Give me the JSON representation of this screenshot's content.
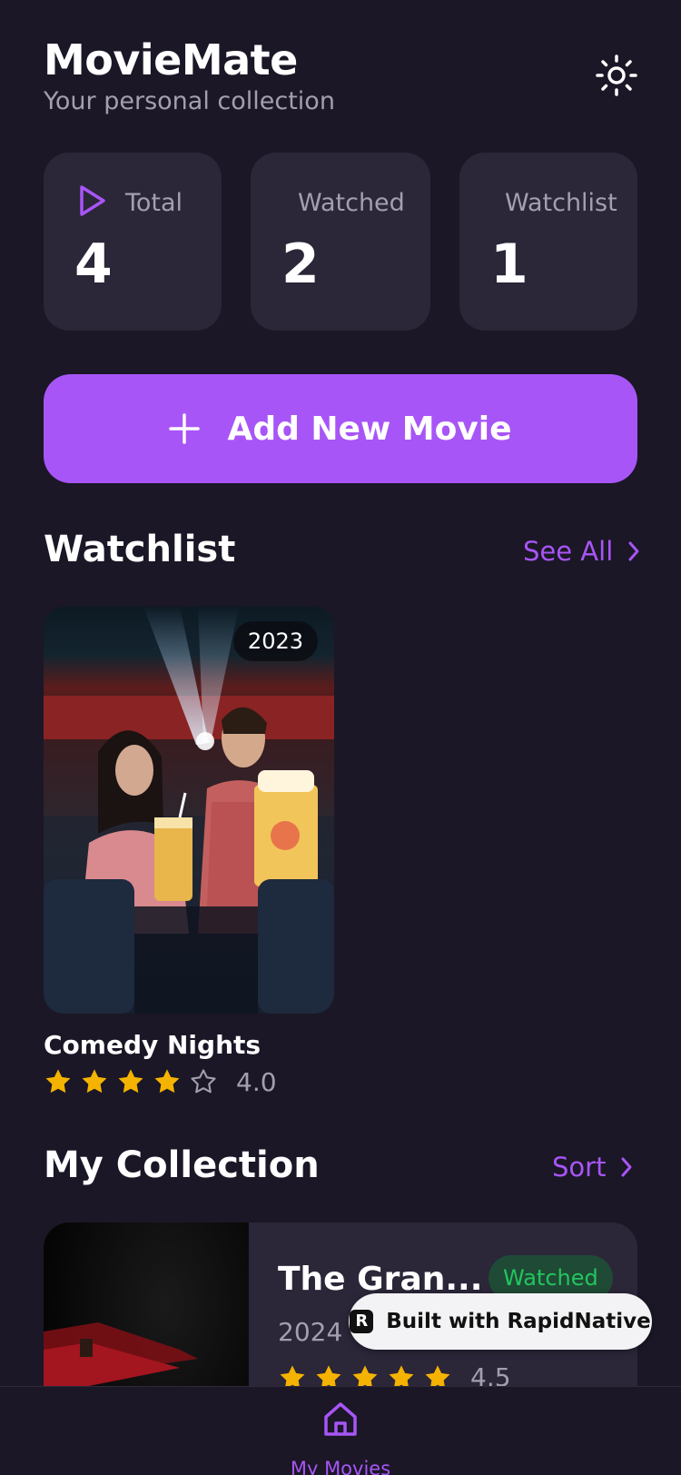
{
  "header": {
    "title": "MovieMate",
    "subtitle": "Your personal collection",
    "theme_icon": "sun-icon"
  },
  "stats": [
    {
      "label": "Total",
      "value": "4",
      "icon": "play-icon"
    },
    {
      "label": "Watched",
      "value": "2"
    },
    {
      "label": "Watchlist",
      "value": "1"
    }
  ],
  "add_button": {
    "label": "Add New Movie",
    "icon": "plus-icon"
  },
  "watchlist": {
    "title": "Watchlist",
    "see_all": "See All",
    "items": [
      {
        "title": "Comedy Nights",
        "year": "2023",
        "rating": 4.0,
        "rating_text": "4.0"
      }
    ]
  },
  "collection": {
    "title": "My Collection",
    "sort": "Sort",
    "items": [
      {
        "title": "The Gran...",
        "status": "Watched",
        "year": "2024",
        "rating": 4.5,
        "rating_text": "4.5"
      }
    ]
  },
  "badge": {
    "text": "Built with RapidNative"
  },
  "tabbar": {
    "active_label": "My Movies",
    "icon": "home-icon"
  },
  "colors": {
    "background": "#1b1726",
    "card": "#2b2638",
    "accent": "#a855f7",
    "star": "#f5b301",
    "watched_badge": "#22c55e"
  }
}
